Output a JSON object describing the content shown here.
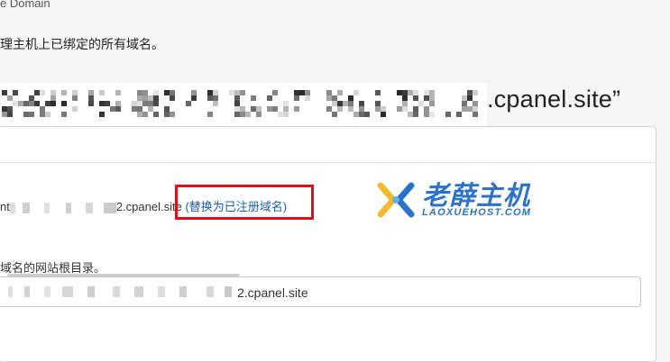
{
  "breadcrumb": {
    "text": "e Domain"
  },
  "description": {
    "text": "理主机上已绑定的所有域名。"
  },
  "heading": {
    "visible_text": ".cpanel.site”"
  },
  "domain_row": {
    "prefix": "nt",
    "suffix": "2.cpanel.site",
    "replace_link": "(替换为已注册域名)"
  },
  "logo": {
    "main": "老薛主机",
    "sub": "LAOXUEHOST.COM"
  },
  "document_root": {
    "label": "域名的网站根目录。",
    "value_visible": "2.cpanel.site"
  },
  "colors": {
    "link": "#1c5fa8",
    "highlight": "#d9111b",
    "logo": "#2c72c8"
  }
}
